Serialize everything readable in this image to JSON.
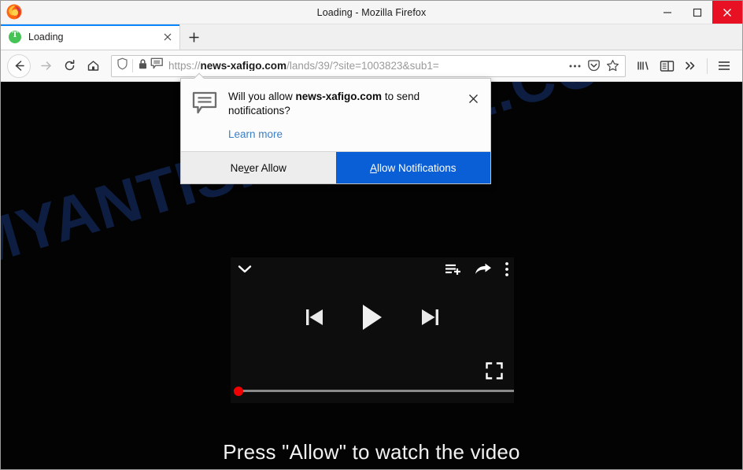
{
  "window": {
    "title": "Loading - Mozilla Firefox",
    "logo_icon": "firefox-logo-icon",
    "minimize_icon": "minimize-icon",
    "maximize_icon": "maximize-icon",
    "close_icon": "close-icon",
    "close_color": "#e81123"
  },
  "tabs": {
    "active": {
      "title": "Loading",
      "favicon": "green-circle-t-favicon",
      "close_icon": "tab-close-icon"
    },
    "new_tab_icon": "plus-icon"
  },
  "navigation": {
    "back_icon": "back-arrow-icon",
    "forward_icon": "forward-arrow-icon",
    "reload_icon": "reload-icon",
    "home_icon": "home-icon",
    "library_icon": "library-icon",
    "sidebar_icon": "sidebar-toggle-icon",
    "overflow_icon": "chevron-double-right-icon",
    "menu_icon": "hamburger-menu-icon"
  },
  "urlbar": {
    "shield_icon": "tracking-protection-shield-icon",
    "lock_icon": "padlock-icon",
    "notification_icon": "notification-permission-icon",
    "scheme": "https://",
    "host": "news-xafigo.com",
    "path": "/lands/39/?site=1003823&sub1=",
    "full_url": "https://news-xafigo.com/lands/39/?site=1003823&sub1=",
    "page_actions_icon": "ellipsis-icon",
    "pocket_icon": "pocket-icon",
    "bookmark_icon": "star-icon"
  },
  "popup": {
    "icon": "speech-bubble-notification-icon",
    "message_prefix": "Will you allow ",
    "message_domain": "news-xafigo.com",
    "message_suffix": " to send notifications?",
    "learn_more": "Learn more",
    "close_icon": "popup-close-icon",
    "never_allow": {
      "before": "Ne",
      "key": "v",
      "after": "er Allow"
    },
    "allow": {
      "key": "A",
      "after": "llow Notifications"
    },
    "primary_color": "#0a5fd6"
  },
  "page": {
    "background_color": "#030303",
    "watermark": "MYANTISPYWARE.COM",
    "watermark_color": "#0e2148",
    "cta_text": "Press \"Allow\" to watch the video",
    "player": {
      "collapse_icon": "chevron-down-icon",
      "playlist_add_icon": "playlist-add-icon",
      "share_icon": "share-arrow-icon",
      "more_icon": "more-vertical-icon",
      "previous_icon": "previous-track-icon",
      "play_icon": "play-icon",
      "next_icon": "next-track-icon",
      "fullscreen_icon": "fullscreen-icon",
      "progress_percent": 0,
      "progress_dot_color": "#f00000"
    }
  }
}
